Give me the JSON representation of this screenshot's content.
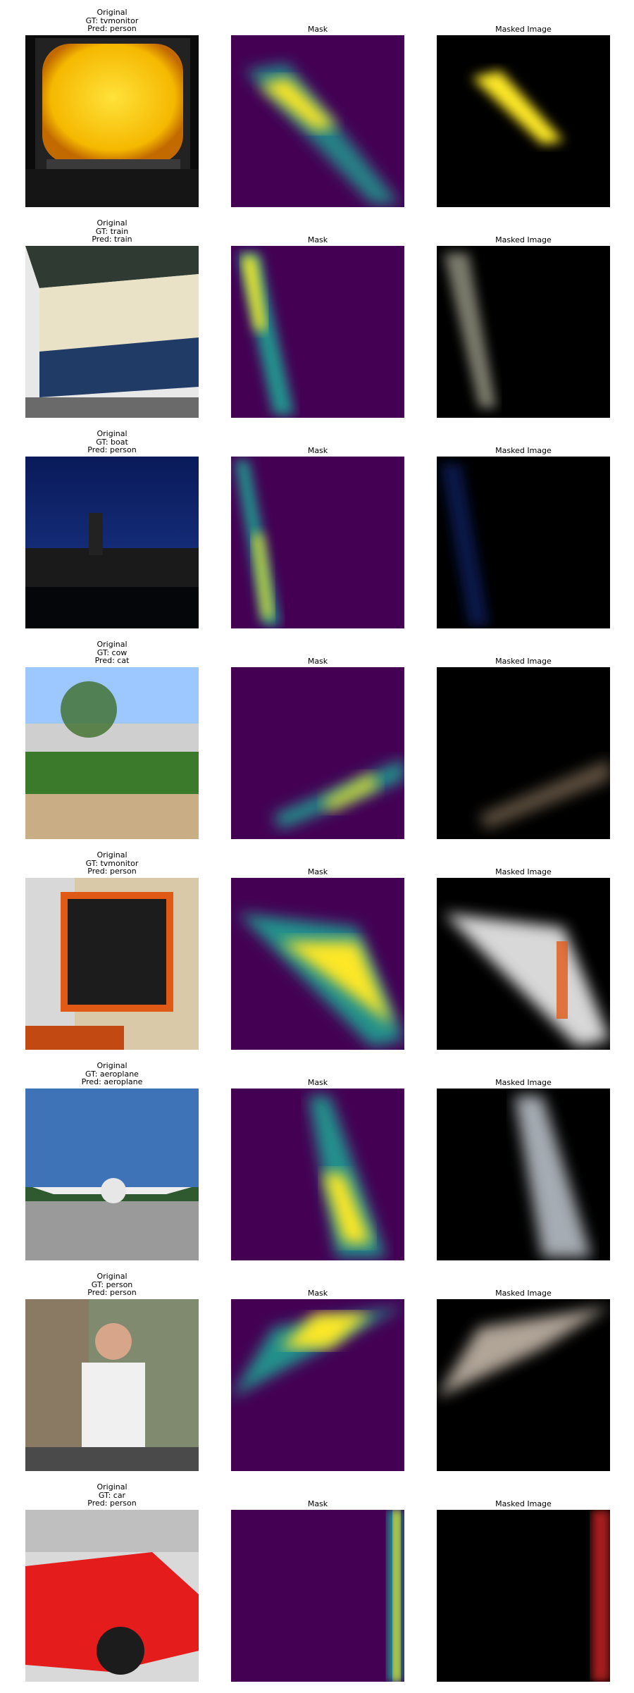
{
  "figure": {
    "column_titles": {
      "mask": "Mask",
      "masked": "Masked Image"
    },
    "rows": [
      {
        "original": "Original",
        "gt": "GT: tvmonitor",
        "pred": "Pred: person"
      },
      {
        "original": "Original",
        "gt": "GT: train",
        "pred": "Pred: train"
      },
      {
        "original": "Original",
        "gt": "GT: boat",
        "pred": "Pred: person"
      },
      {
        "original": "Original",
        "gt": "GT: cow",
        "pred": "Pred: cat"
      },
      {
        "original": "Original",
        "gt": "GT: tvmonitor",
        "pred": "Pred: person"
      },
      {
        "original": "Original",
        "gt": "GT: aeroplane",
        "pred": "Pred: aeroplane"
      },
      {
        "original": "Original",
        "gt": "GT: person",
        "pred": "Pred: person"
      },
      {
        "original": "Original",
        "gt": "GT: car",
        "pred": "Pred: person"
      }
    ]
  },
  "colors": {
    "mask_background": "#440154",
    "mask_mid": "#21918c",
    "mask_high": "#fde725"
  }
}
